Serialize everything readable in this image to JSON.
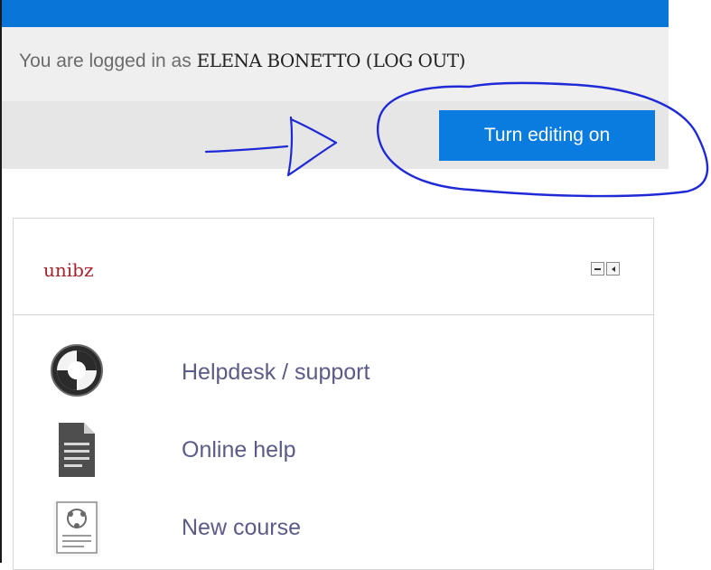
{
  "header": {
    "login_prefix": "You are logged in as",
    "user_name": "ELENA BONETTO",
    "logout_label": "LOG OUT",
    "edit_button_label": "Turn editing on"
  },
  "block": {
    "title": "unibz",
    "items": [
      {
        "label": "Helpdesk / support",
        "icon": "lifebuoy-icon"
      },
      {
        "label": "Online help",
        "icon": "document-icon"
      },
      {
        "label": "New course",
        "icon": "course-icon"
      }
    ]
  },
  "colors": {
    "top_bar": "#0a75d9",
    "button": "#0a7ce0",
    "annotation_ink": "#1f2ad6",
    "title": "#a5222d",
    "link": "#5b5b87"
  }
}
